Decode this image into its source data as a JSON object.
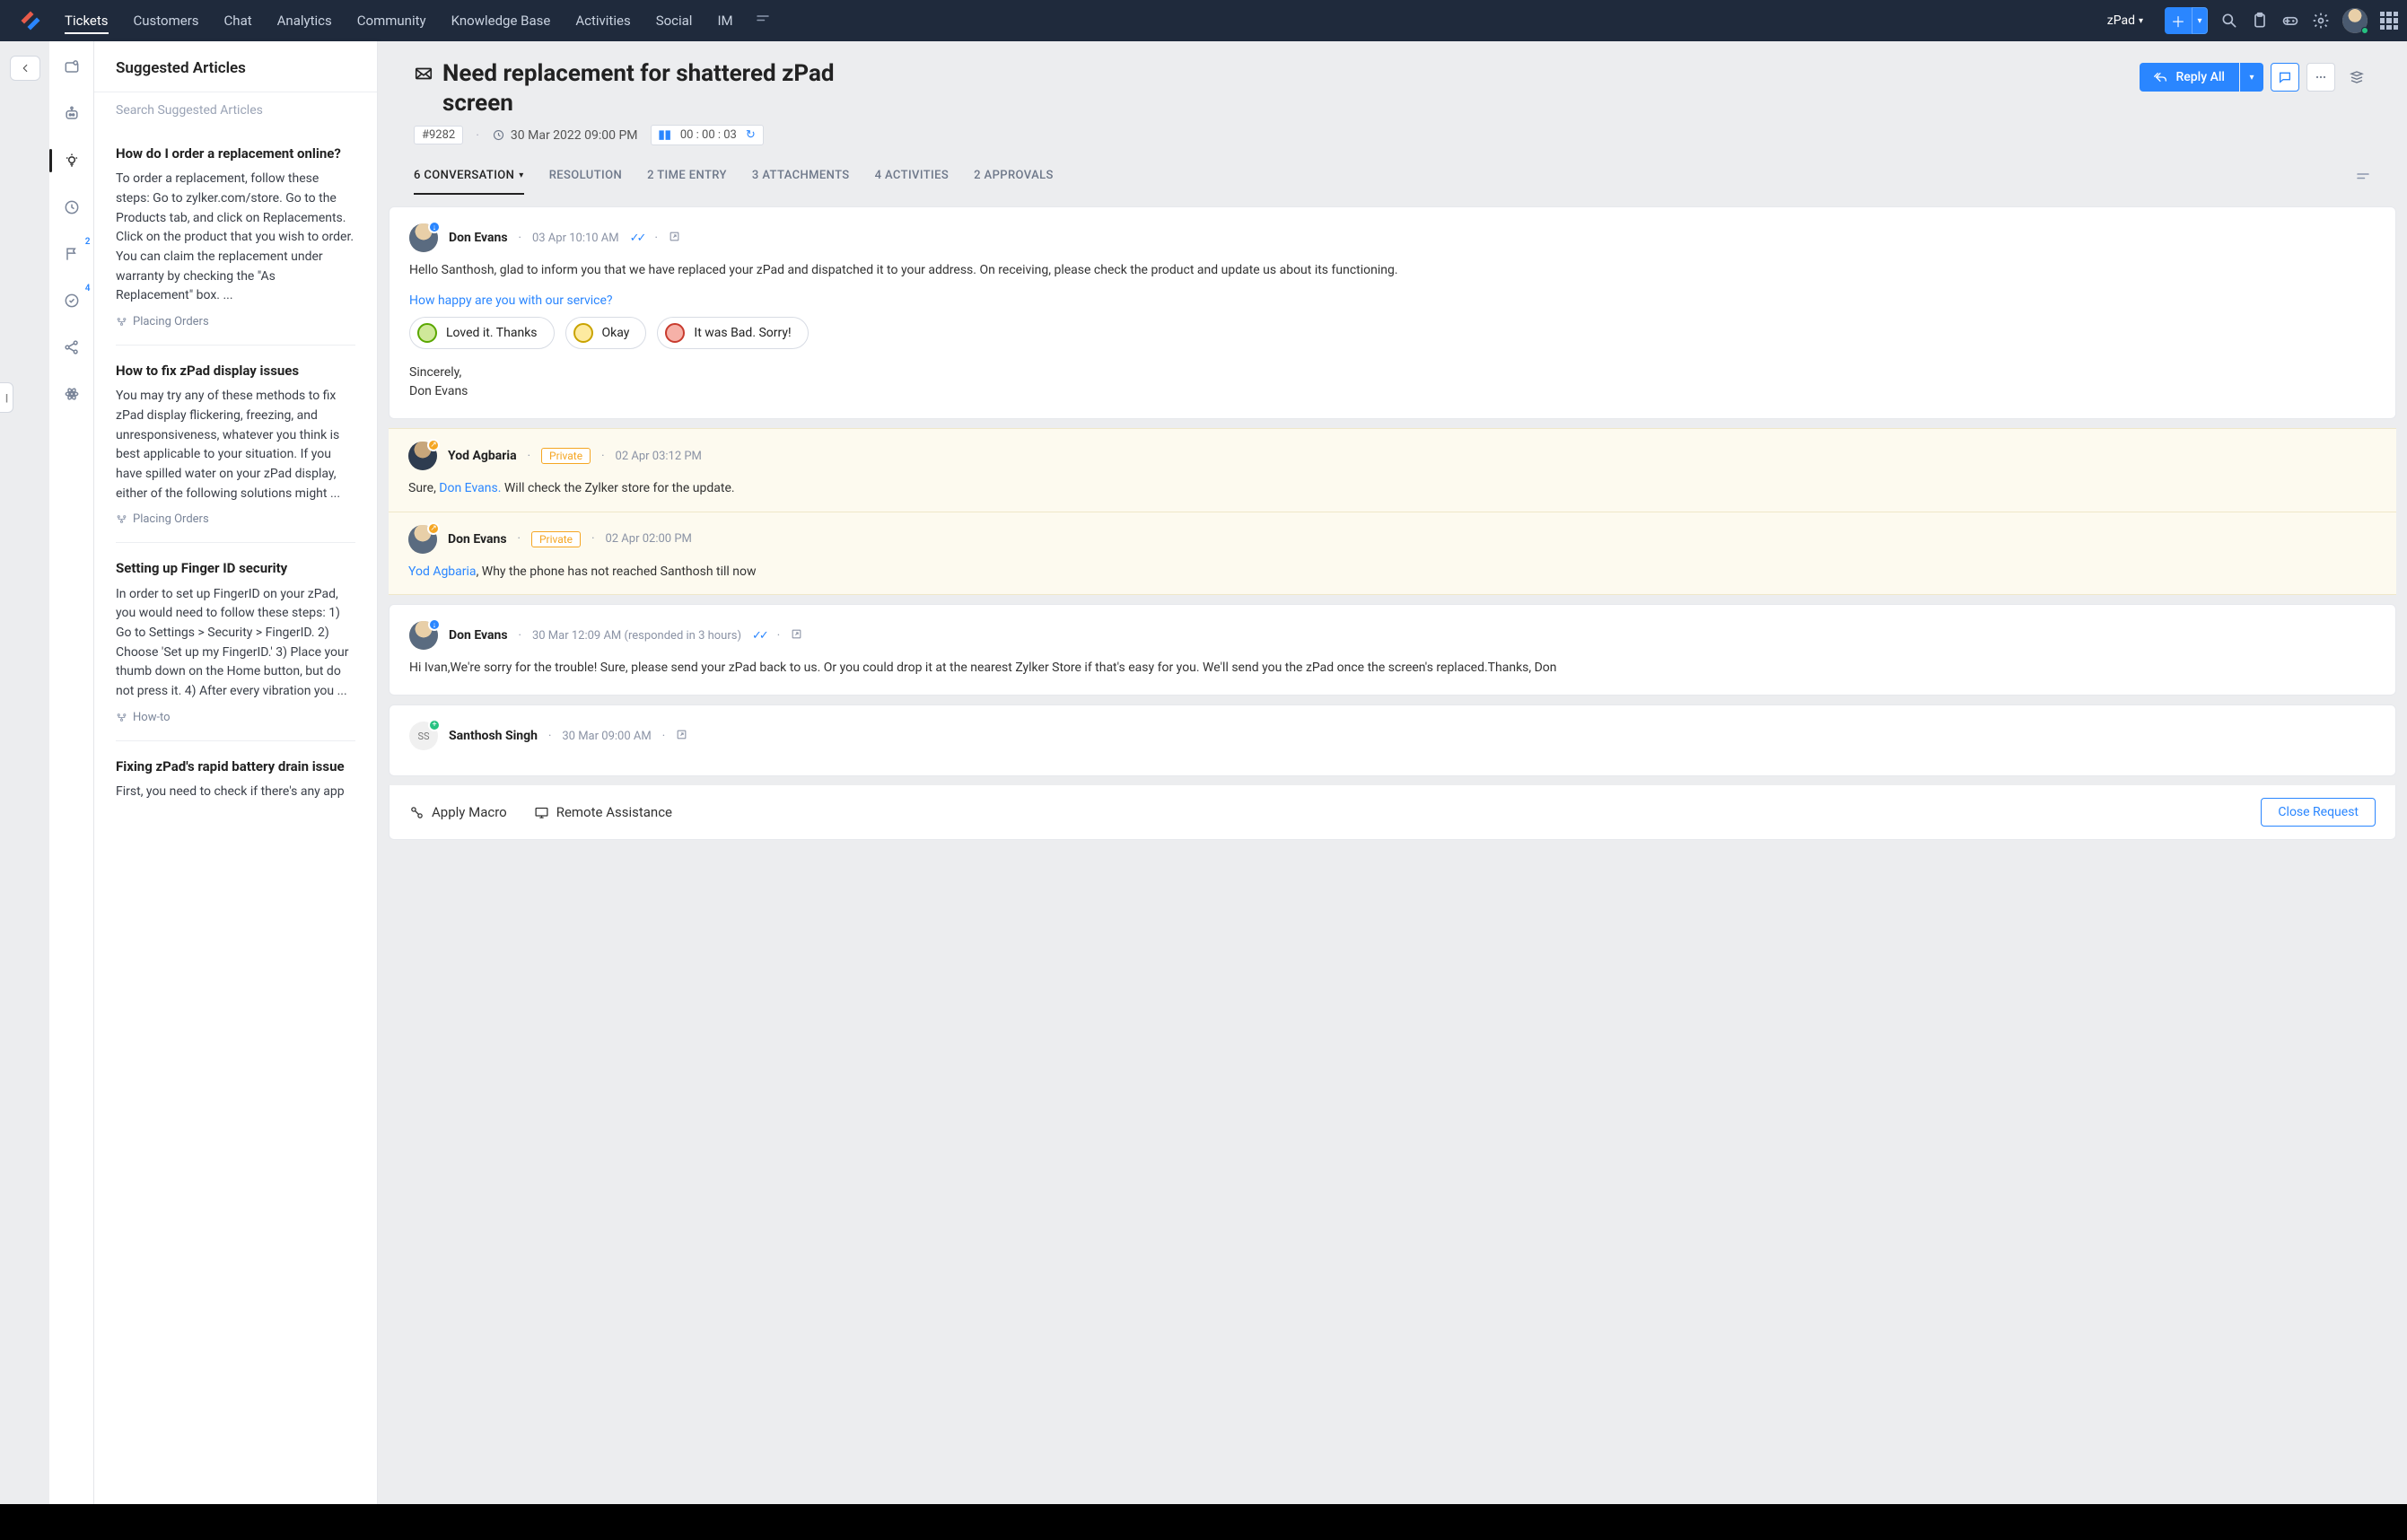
{
  "nav": {
    "links": [
      "Tickets",
      "Customers",
      "Chat",
      "Analytics",
      "Community",
      "Knowledge Base",
      "Activities",
      "Social",
      "IM"
    ],
    "active": "Tickets",
    "workspace": "zPad"
  },
  "articles_panel": {
    "title": "Suggested Articles",
    "search_placeholder": "Search Suggested Articles",
    "items": [
      {
        "title": "How do I order a replacement online?",
        "body": "To order a replacement, follow these steps:  Go to zylker.com/store. Go to the Products tab, and click on Replacements. Click on the product that you wish to order.  You can claim the replacement under warranty by checking the \"As Replacement\" box. ...",
        "category": "Placing Orders"
      },
      {
        "title": "How to fix zPad display issues",
        "body": "You may try any of these methods to fix zPad display flickering, freezing, and unresponsiveness, whatever you think is best applicable to your situation. If you have spilled water on your zPad display, either of the following solutions might ...",
        "category": "Placing Orders"
      },
      {
        "title": "Setting up Finger ID security",
        "body": "In order to set up FingerID on your zPad, you would need to follow these steps: 1) Go to Settings > Security > FingerID. 2) Choose 'Set up my FingerID.' 3) Place your thumb down on the Home button, but do not press it. 4) After every vibration you ...",
        "category": "How-to"
      },
      {
        "title": "Fixing zPad's rapid battery drain issue",
        "body": "First, you need to check if there's any app",
        "category": ""
      }
    ]
  },
  "ticket": {
    "title": "Need replacement for shattered zPad screen",
    "id": "#9282",
    "datetime": "30 Mar 2022 09:00 PM",
    "timer": "00 : 00 : 03",
    "reply_label": "Reply All"
  },
  "tabs": {
    "items": [
      {
        "label": "6 CONVERSATION",
        "dropdown": true
      },
      {
        "label": "RESOLUTION"
      },
      {
        "label": "2 TIME ENTRY"
      },
      {
        "label": "3 ATTACHMENTS"
      },
      {
        "label": "4 ACTIVITIES"
      },
      {
        "label": "2 APPROVALS"
      }
    ]
  },
  "thread": [
    {
      "type": "agent",
      "author": "Don Evans",
      "time": "03 Apr 10:10 AM",
      "badge": "in",
      "ticks": true,
      "popout": true,
      "body": "Hello Santhosh, glad to inform you that we have replaced your zPad and dispatched it to your address. On receiving, please check the product and update us about its functioning.",
      "rating_question": "How happy are you with our service?",
      "ratings": [
        "Loved it. Thanks",
        "Okay",
        "It was Bad. Sorry!"
      ],
      "signoff1": "Sincerely,",
      "signoff2": "Don Evans"
    },
    {
      "type": "private",
      "author": "Yod Agbaria",
      "time": "02 Apr 03:12 PM",
      "badge": "out",
      "body_pre": "Sure, ",
      "mention": "Don Evans.",
      "body_post": " Will check the Zylker store for the update."
    },
    {
      "type": "private",
      "author": "Don Evans",
      "time": "02 Apr 02:00 PM",
      "badge": "out",
      "mention": "Yod Agbaria",
      "body_post": ",  Why the phone has not reached Santhosh till now"
    },
    {
      "type": "agent",
      "author": "Don Evans",
      "time": "30 Mar 12:09 AM (responded in 3 hours)",
      "badge": "in",
      "ticks": true,
      "popout": true,
      "body": "Hi Ivan,We're sorry for the trouble! Sure, please send your zPad back to us. Or you could drop it at the nearest Zylker Store if that's easy for you. We'll send you the zPad once the screen's replaced.Thanks, Don"
    },
    {
      "type": "customer",
      "author": "Santhosh Singh",
      "time": "30 Mar 09:00 AM",
      "badge": "new",
      "initials": "SS",
      "popout": true
    }
  ],
  "footer": {
    "macro": "Apply Macro",
    "remote": "Remote Assistance",
    "close": "Close Request"
  },
  "private_label": "Private"
}
